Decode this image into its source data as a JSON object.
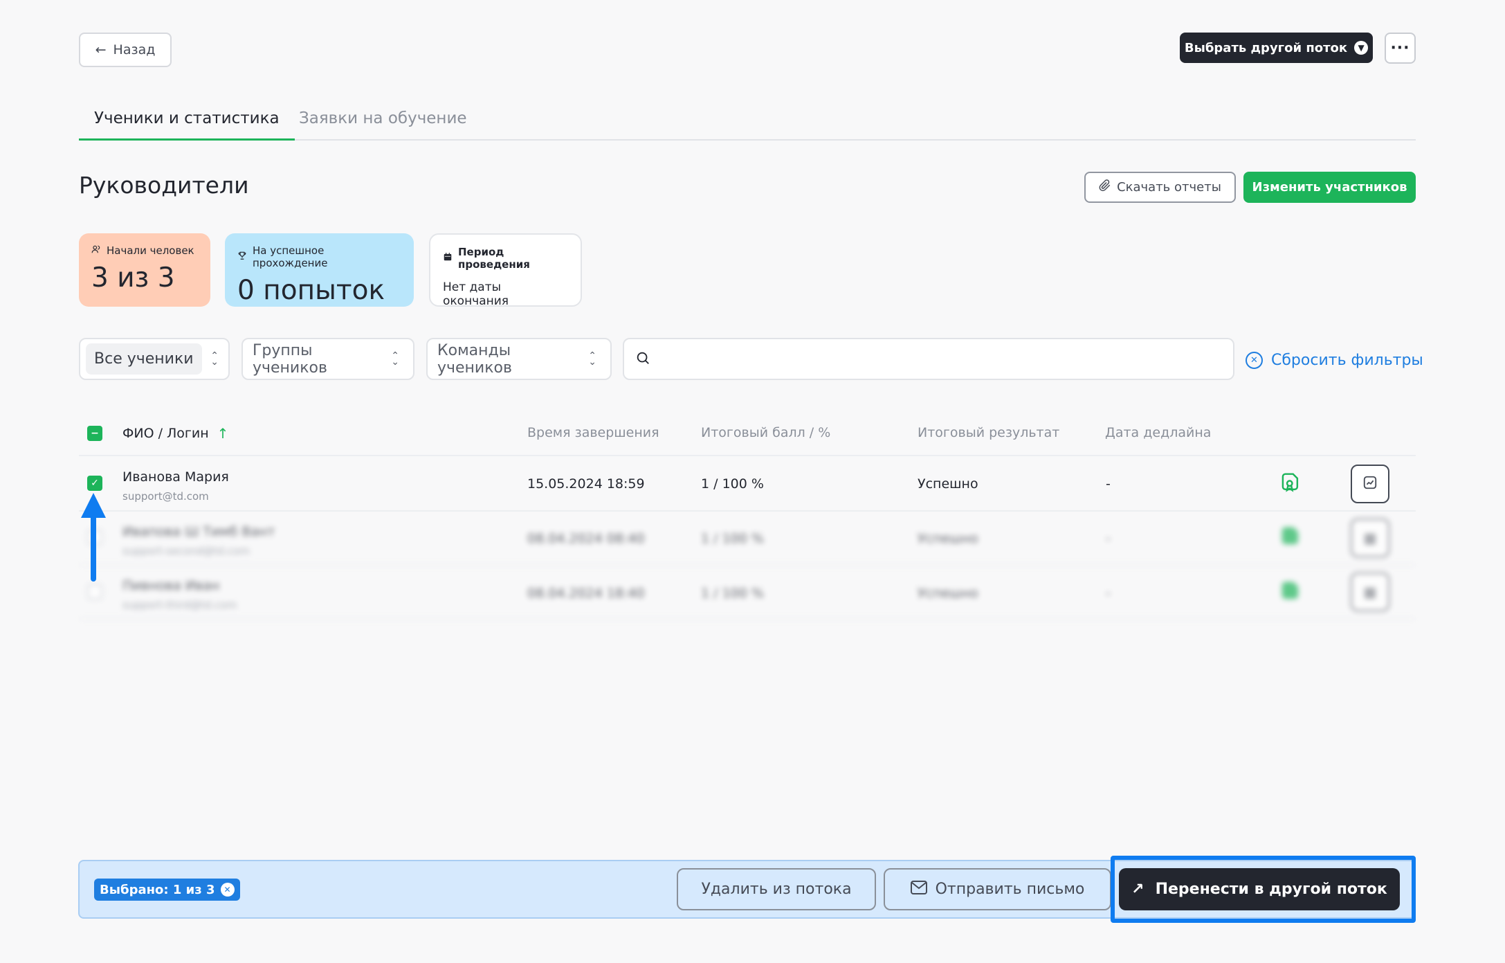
{
  "header": {
    "back_label": "Назад",
    "choose_stream_label": "Выбрать другой поток",
    "more_label": "···"
  },
  "tabs": [
    {
      "label": "Ученики и статистика",
      "active": true
    },
    {
      "label": "Заявки на обучение",
      "active": false
    }
  ],
  "page": {
    "title": "Руководители",
    "download_label": "Скачать отчеты",
    "change_label": "Изменить участников"
  },
  "stats": {
    "started": {
      "label": "Начали человек",
      "value": "3 из 3"
    },
    "attempts": {
      "label": "На успешное прохождение",
      "value": "0 попыток"
    },
    "period": {
      "label": "Период проведения",
      "value": "Нет даты окончания"
    }
  },
  "filters": {
    "students": "Все ученики",
    "groups": "Группы учеников",
    "teams": "Команды учеников",
    "search_placeholder": "",
    "reset_label": "Сбросить фильтры"
  },
  "table": {
    "columns": {
      "fio": "ФИО / Логин",
      "finish_time": "Время завершения",
      "score": "Итоговый балл / %",
      "result": "Итоговый результат",
      "deadline": "Дата дедлайна"
    },
    "rows": [
      {
        "name": "Иванова Мария",
        "login": "support@td.com",
        "finish_time": "15.05.2024 18:59",
        "score": "1 / 100 %",
        "result": "Успешно",
        "deadline": "-",
        "checked": true
      },
      {
        "name": "Ивапова Ш Тимб Вант",
        "login": "support-second@td.com",
        "finish_time": "08.04.2024 08:40",
        "score": "1 / 100 %",
        "result": "Успешно",
        "deadline": "-",
        "checked": false
      },
      {
        "name": "Пивнова Иван",
        "login": "support-third@td.com",
        "finish_time": "08.04.2024 18:40",
        "score": "1 / 100 %",
        "result": "Успешно",
        "deadline": "-",
        "checked": false
      }
    ]
  },
  "bottom_bar": {
    "selected_label": "Выбрано: 1 из 3",
    "delete_label": "Удалить из потока",
    "mail_label": "Отправить письмо",
    "transfer_label": "Перенести в другой поток"
  },
  "colors": {
    "accent_green": "#1db45a",
    "dark": "#23262f",
    "link_blue": "#1f7ee0",
    "annotation_blue": "#0f7cf0"
  }
}
